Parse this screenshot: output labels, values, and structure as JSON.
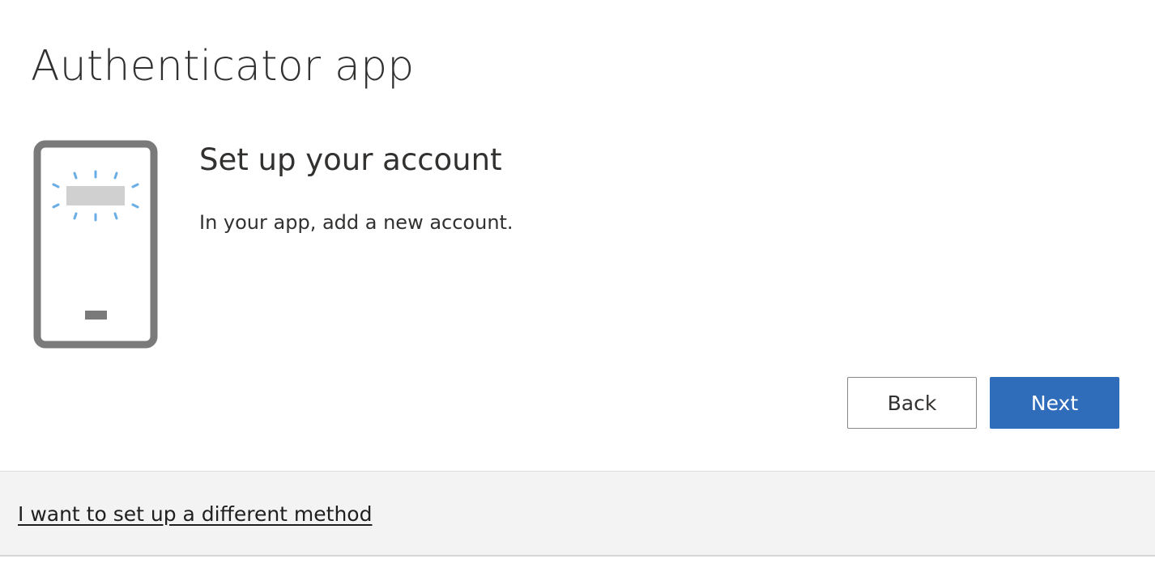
{
  "dialog": {
    "title": "Authenticator app"
  },
  "illustration": {
    "icon": "phone-with-qr-code-icon",
    "accent_color": "#6aaee6",
    "frame_color": "#7a7a7a",
    "screen_bar_color": "#d0d0d0"
  },
  "content": {
    "subtitle": "Set up your account",
    "instruction": "In your app, add a new account."
  },
  "buttons": {
    "back_label": "Back",
    "next_label": "Next",
    "next_color": "#2f6dbb"
  },
  "footer": {
    "link_label": "I want to set up a different method",
    "background": "#f3f3f3"
  }
}
